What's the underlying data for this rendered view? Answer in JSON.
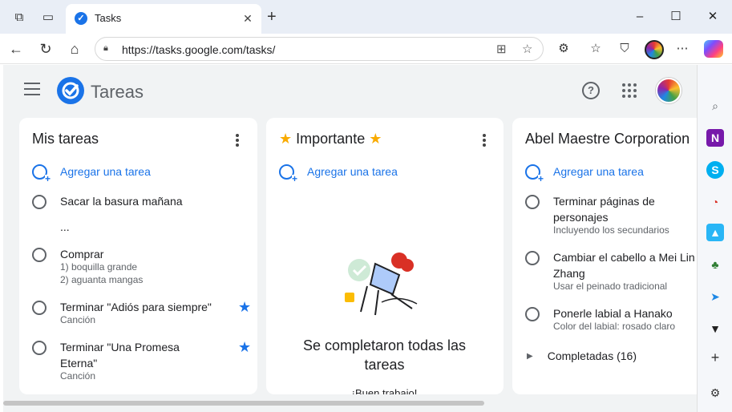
{
  "browser": {
    "tab_title": "Tasks",
    "tab_favicon": "check-circle-icon",
    "url": "https://tasks.google.com/tasks/",
    "window_controls": [
      "minimize",
      "maximize",
      "close"
    ]
  },
  "app": {
    "name": "Tareas",
    "accent_color": "#1a73e8"
  },
  "lists": [
    {
      "title": "Mis tareas",
      "add_task_label": "Agregar una tarea",
      "tasks": [
        {
          "title": "Sacar la basura mañana",
          "details": [],
          "starred": false
        },
        {
          "title": "...",
          "details": [],
          "starred": false
        },
        {
          "title": "Comprar",
          "details": [
            "1) boquilla grande",
            "2) aguanta mangas"
          ],
          "starred": false
        },
        {
          "title": "Terminar \"Adiós para siempre\"",
          "details": [
            "Canción"
          ],
          "starred": true
        },
        {
          "title": "Terminar \"Una Promesa",
          "title_line2": "Eterna\"",
          "details": [
            "Canción"
          ],
          "starred": true
        }
      ]
    },
    {
      "title_prefix_icon": "star-icon",
      "title": "Importante",
      "title_suffix_icon": "star-icon",
      "add_task_label": "Agregar una tarea",
      "empty_message": "Se completaron todas las tareas",
      "empty_sub": "¡Buen trabajo!"
    },
    {
      "title": "Abel Maestre Corporation",
      "add_task_label": "Agregar una tarea",
      "tasks": [
        {
          "title": "Terminar páginas de",
          "title_line2": "personajes",
          "details": [
            "Incluyendo los secundarios"
          ]
        },
        {
          "title": "Cambiar el cabello a Mei Lin",
          "title_line2": "Zhang",
          "details": [
            "Usar el peinado tradicional"
          ]
        },
        {
          "title": "Ponerle labial a Hanako",
          "details": [
            "Color del labial: rosado claro"
          ]
        }
      ],
      "completed_label": "Completadas (16)"
    }
  ]
}
